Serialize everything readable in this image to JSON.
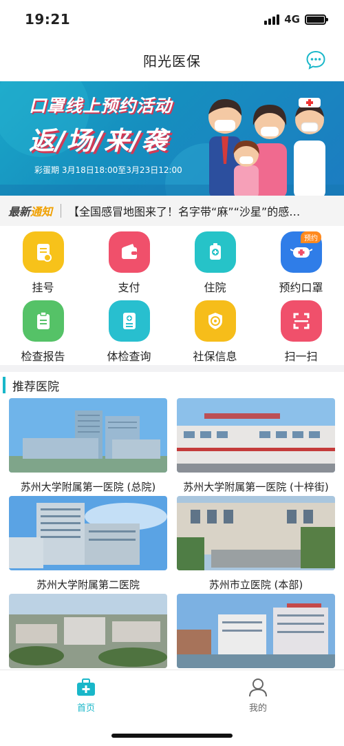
{
  "status": {
    "time": "19:21",
    "network": "4G"
  },
  "nav": {
    "title": "阳光医保"
  },
  "banner": {
    "line1": "口罩线上预约活动",
    "line2": "返/场/来/袭",
    "line3": "彩蛋期  3月18日18:00至3月23日12:00"
  },
  "notice": {
    "tag_prefix": "最新",
    "tag_suffix": "通知",
    "text": "【全国感冒地图来了！名字带“麻”“沙星”的感…"
  },
  "grid": [
    {
      "label": "挂号",
      "color": "#f7c21a",
      "icon": "register-doc-icon"
    },
    {
      "label": "支付",
      "color": "#f0506b",
      "icon": "wallet-icon"
    },
    {
      "label": "住院",
      "color": "#26c3c8",
      "icon": "hospital-badge-icon"
    },
    {
      "label": "预约口罩",
      "color": "#2f7de8",
      "icon": "mask-icon",
      "badge": "预约"
    },
    {
      "label": "检查报告",
      "color": "#55c267",
      "icon": "report-clipboard-icon"
    },
    {
      "label": "体检查询",
      "color": "#28bfcf",
      "icon": "checkup-doc-icon"
    },
    {
      "label": "社保信息",
      "color": "#f6bd1a",
      "icon": "social-security-icon"
    },
    {
      "label": "扫一扫",
      "color": "#f0506b",
      "icon": "scan-icon"
    }
  ],
  "recommend": {
    "title": "推荐医院",
    "hospitals": [
      {
        "name": "苏州大学附属第一医院 (总院)"
      },
      {
        "name": "苏州大学附属第一医院 (十梓街)"
      },
      {
        "name": "苏州大学附属第二医院"
      },
      {
        "name": "苏州市立医院 (本部)"
      },
      {
        "name": ""
      },
      {
        "name": ""
      }
    ]
  },
  "tabs": [
    {
      "label": "首页",
      "active": true
    },
    {
      "label": "我的",
      "active": false
    }
  ],
  "colors": {
    "accent": "#19b7c9",
    "inactive": "#666666"
  }
}
